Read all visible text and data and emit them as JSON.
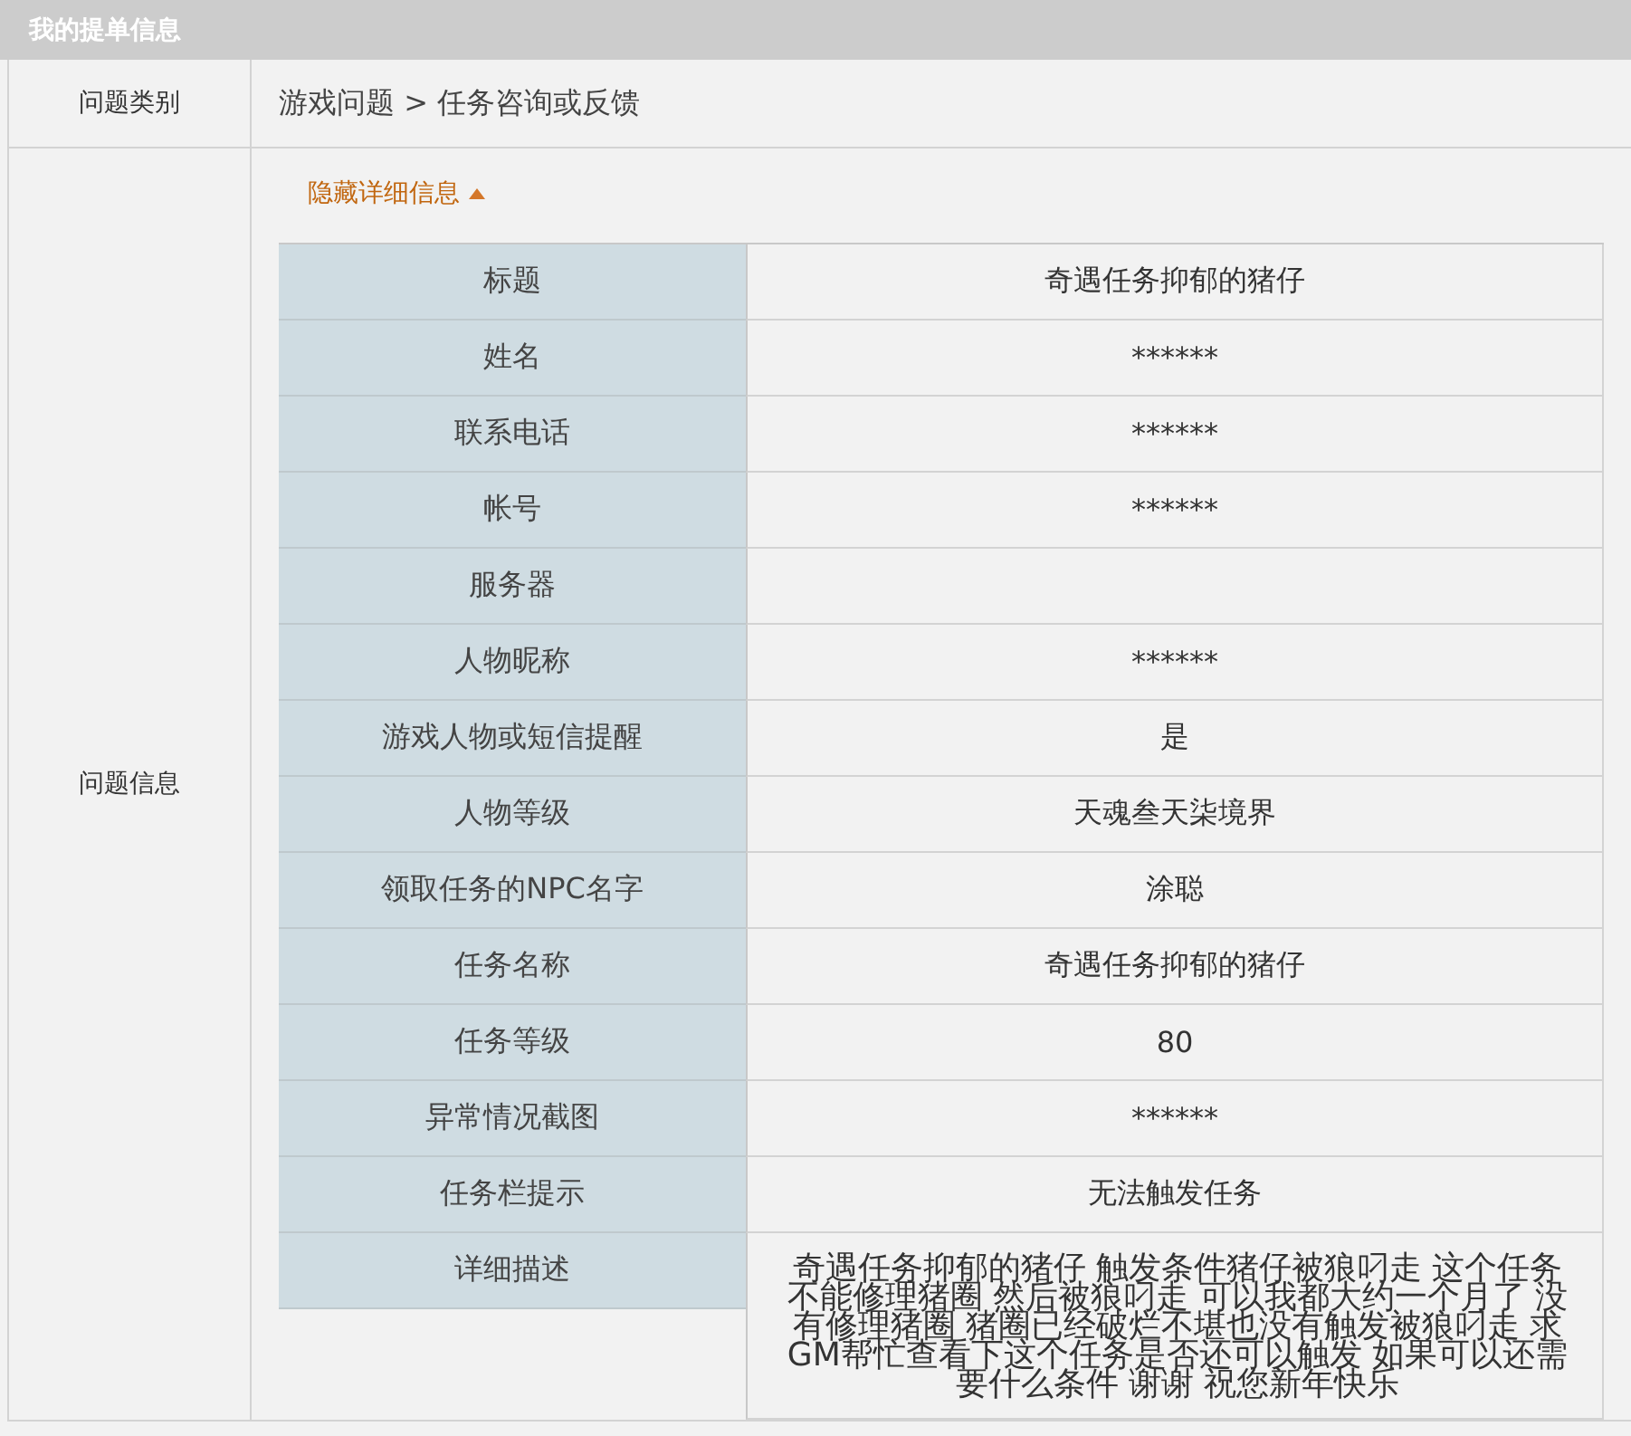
{
  "header": {
    "title": "我的提单信息"
  },
  "category": {
    "label": "问题类别",
    "value": "游戏问题 > 任务咨询或反馈"
  },
  "info": {
    "label": "问题信息",
    "toggle": {
      "label": "隐藏详细信息",
      "expanded": true
    },
    "fields": [
      {
        "label": "标题",
        "value": "奇遇任务抑郁的猪仔"
      },
      {
        "label": "姓名",
        "value": "******"
      },
      {
        "label": "联系电话",
        "value": "******"
      },
      {
        "label": "帐号",
        "value": "******"
      },
      {
        "label": "服务器"
      },
      {
        "label": "人物昵称",
        "value": "******"
      },
      {
        "label": "游戏人物或短信提醒",
        "value": "是"
      },
      {
        "label": "人物等级",
        "value": "天魂叁天柒境界"
      },
      {
        "label": "领取任务的NPC名字",
        "value": "涂聪"
      },
      {
        "label": "任务名称",
        "value": "奇遇任务抑郁的猪仔"
      },
      {
        "label": "任务等级",
        "value": "80"
      },
      {
        "label": "异常情况截图",
        "value": "******"
      },
      {
        "label": "任务栏提示",
        "value": "无法触发任务"
      },
      {
        "label": "详细描述",
        "value": "奇遇任务抑郁的猪仔 触发条件猪仔被狼叼走 这个任务不能修理猪圈 然后被狼叼走 可以我都大约一个月了 没有修理猪圈 猪圈已经破烂不堪也没有触发被狼叼走 求GM帮忙查看下这个任务是否还可以触发 如果可以还需要什么条件 谢谢 祝您新年快乐"
      }
    ]
  }
}
